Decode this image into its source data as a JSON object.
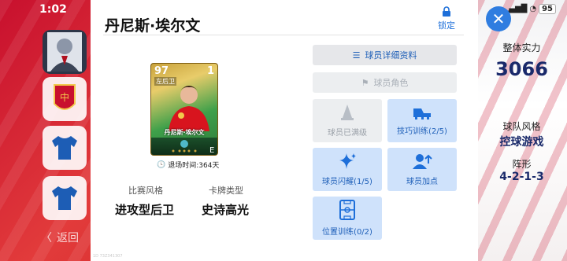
{
  "status_bar": {
    "time": "1:02",
    "battery": "95"
  },
  "left_sidebar": {
    "back_label": "返回"
  },
  "modal": {
    "title": "丹尼斯·埃尔文",
    "lock_label": "锁定",
    "card": {
      "rating": "97",
      "number": "1",
      "position": "左后卫",
      "name": "丹尼斯·埃尔文"
    },
    "retire_text": "退场时间:364天",
    "play_style_label": "比赛风格",
    "play_style_value": "进攻型后卫",
    "card_type_label": "卡牌类型",
    "card_type_value": "史诗高光",
    "actions": {
      "details": "球员详细资料",
      "role": "球员角色",
      "maxed": "球员已满级",
      "skill_training": "技巧训练(2/5)",
      "flash": "球员闪耀(1/5)",
      "boost": "球员加点",
      "position_training": "位置训练(0/2)"
    },
    "footer_code": "1D 73Z341307"
  },
  "right_panel": {
    "strength_label": "整体实力",
    "strength_value": "3066",
    "style_label": "球队风格",
    "style_value": "控球游戏",
    "formation_label": "阵形",
    "formation_value": "4-2-1-3"
  },
  "colors": {
    "accent": "#1e6fd9",
    "tile_blue": "#cfe2fb",
    "disabled": "#eceef0"
  }
}
